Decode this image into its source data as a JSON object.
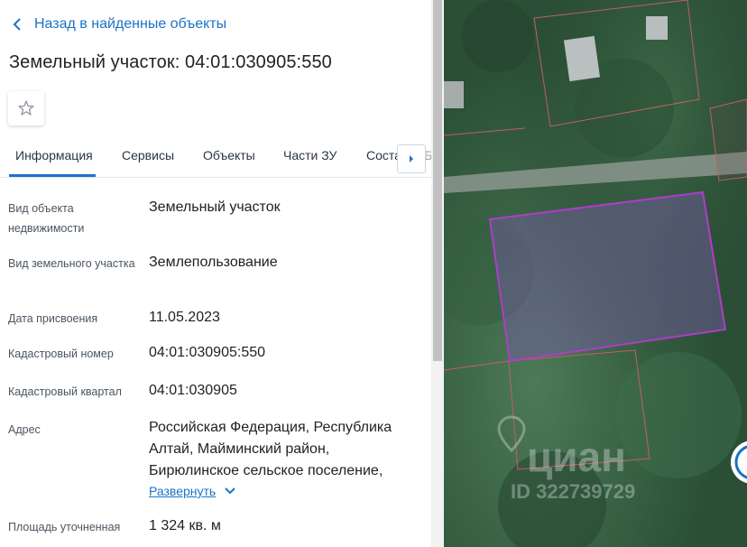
{
  "back_link": "Назад в найденные объекты",
  "title": "Земельный участок: 04:01:030905:550",
  "tabs": [
    "Информация",
    "Сервисы",
    "Объекты",
    "Части ЗУ",
    "Соста"
  ],
  "tab_overflow_text": "Б",
  "fields": [
    {
      "label": "Вид объекта недвижимости",
      "value": "Земельный участок"
    },
    {
      "label": "Вид земельного участка",
      "value": "Землепользование"
    },
    {
      "label": "Дата присвоения",
      "value": "11.05.2023"
    },
    {
      "label": "Кадастровый номер",
      "value": "04:01:030905:550"
    },
    {
      "label": "Кадастровый квартал",
      "value": "04:01:030905"
    },
    {
      "label": "Адрес",
      "value": "Российская Федерация, Республика Алтай, Майминский район, Бирюлинское сельское поселение,"
    },
    {
      "label": "Площадь уточненная",
      "value": "1 324 кв. м"
    }
  ],
  "expand_label": "Развернуть",
  "map": {
    "watermark": "циан",
    "watermark_id": "ID 322739729",
    "parcel_color": "#b03cc8",
    "boundary_color": "#c06060"
  },
  "colors": {
    "accent": "#1a73c8"
  }
}
